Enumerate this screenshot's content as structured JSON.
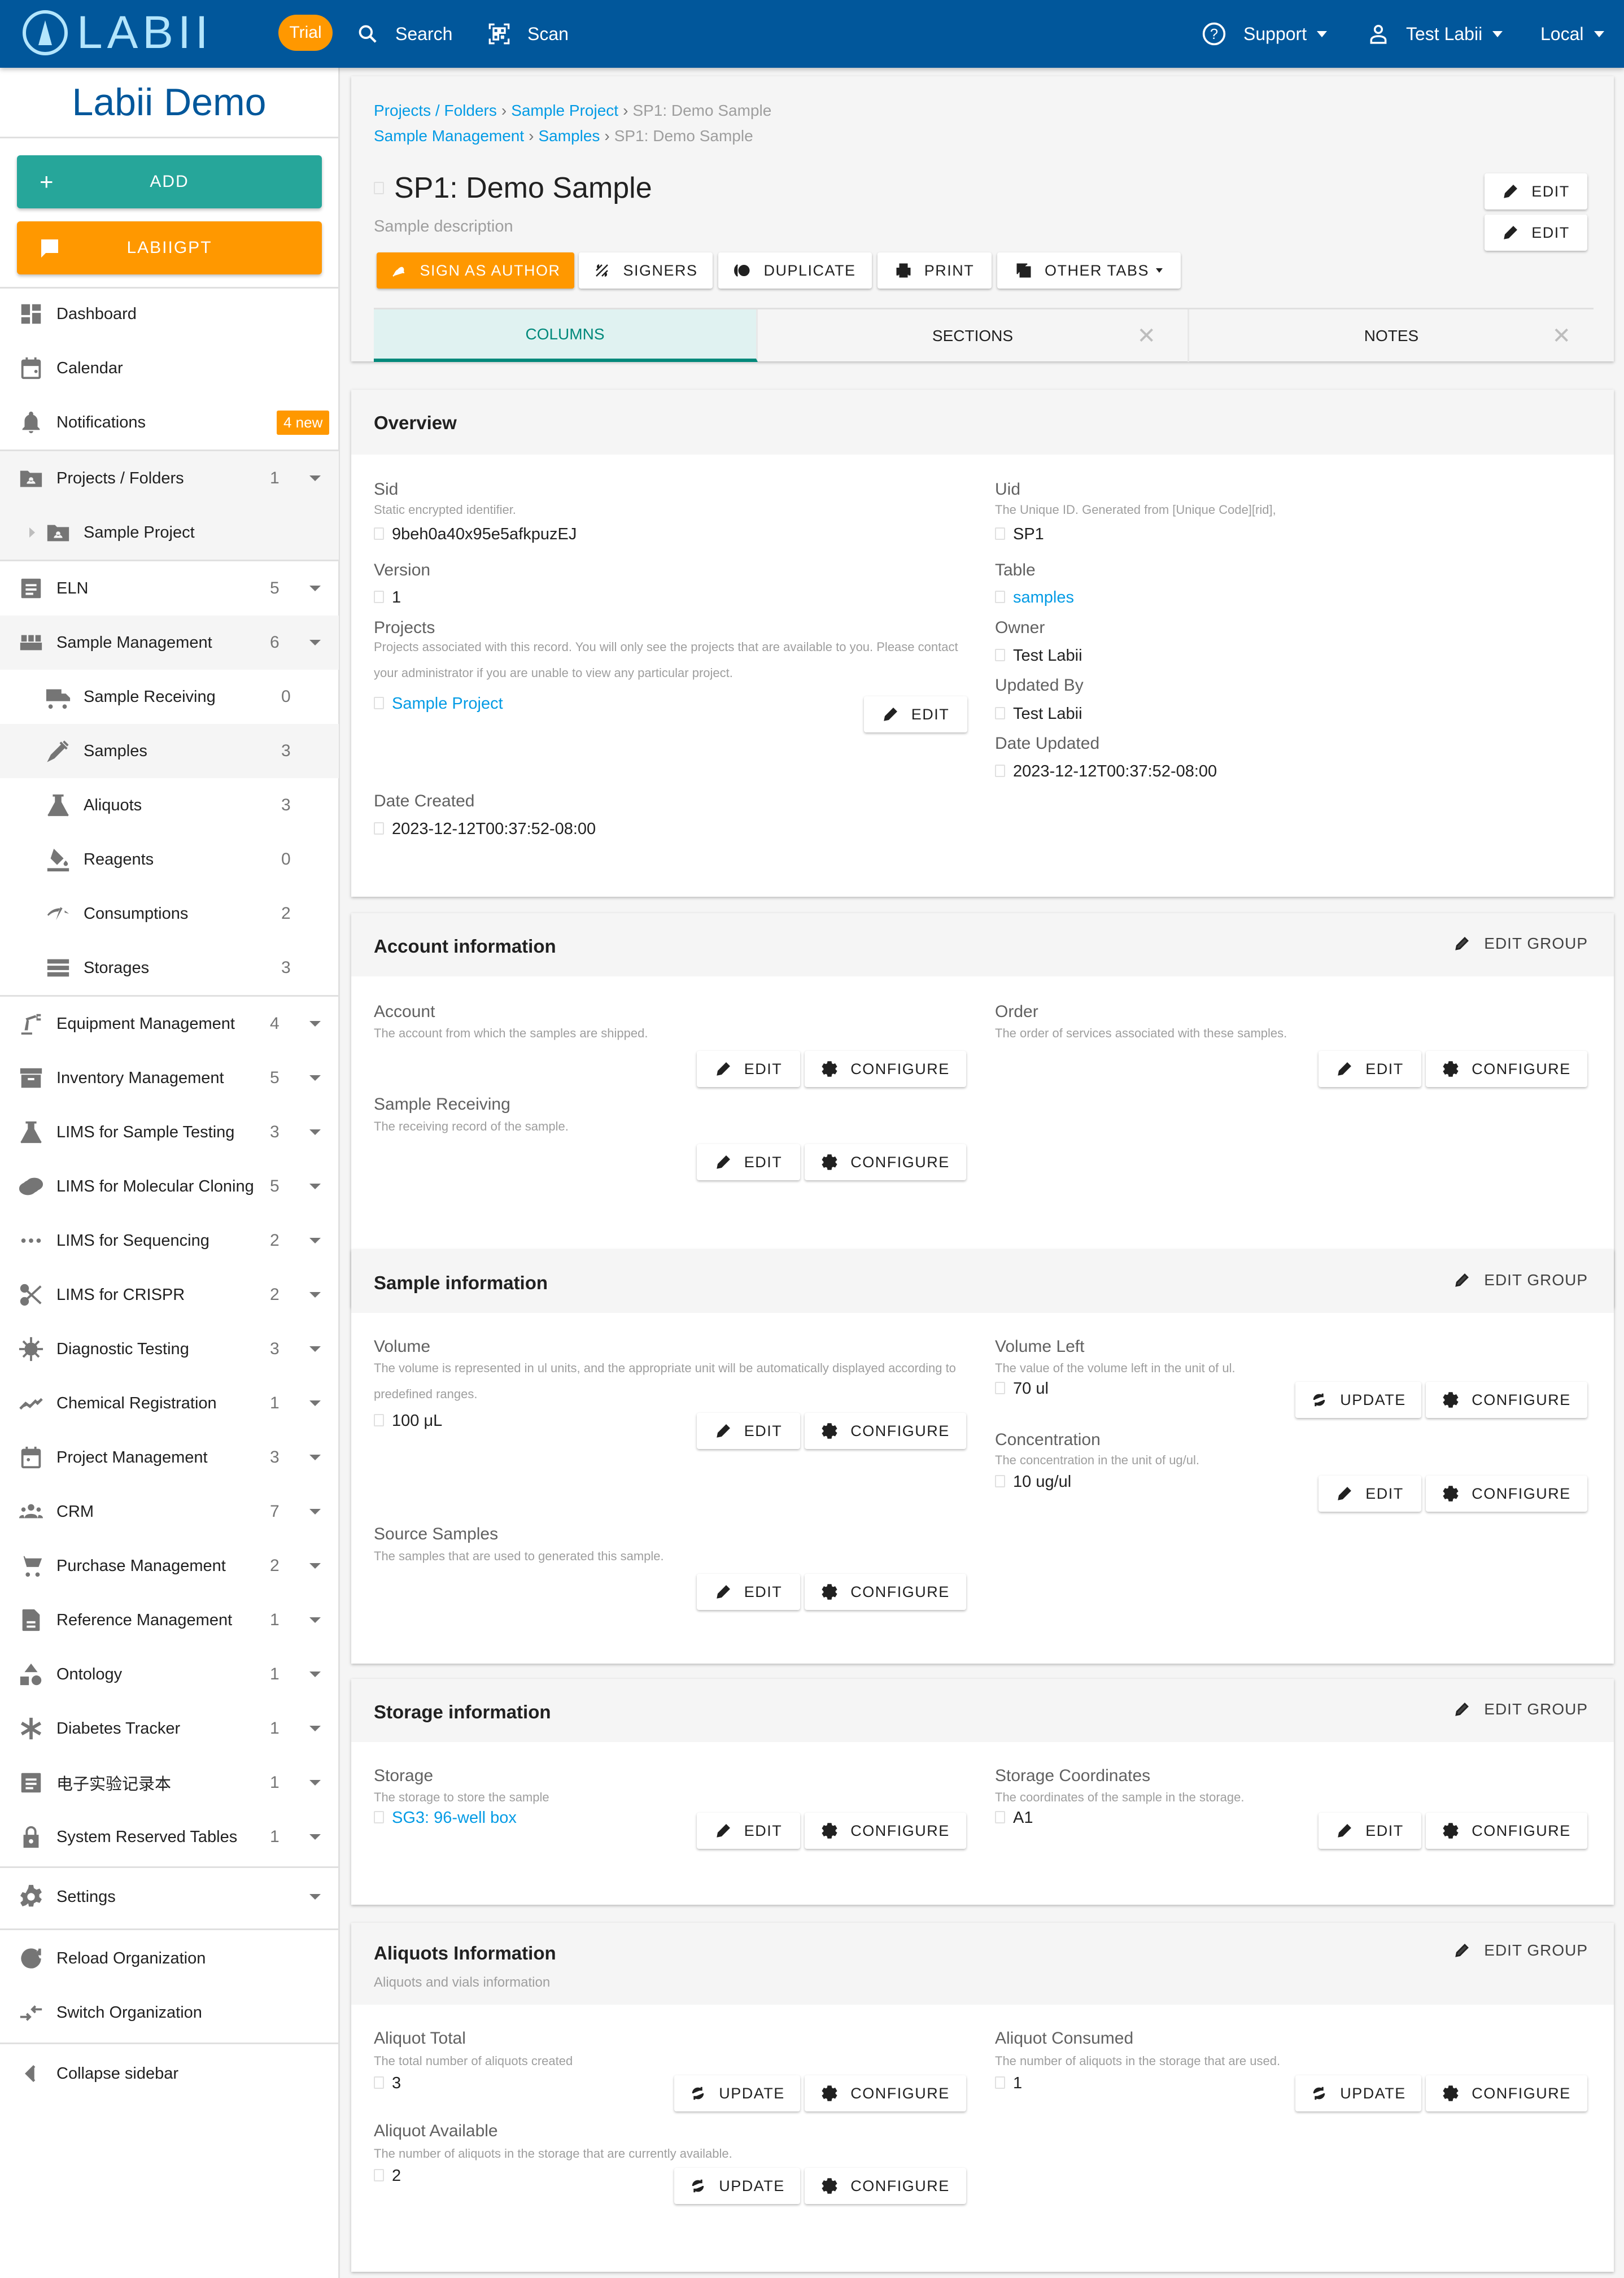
{
  "topbar": {
    "logo_text": "LABII",
    "trial_badge": "Trial",
    "search_label": "Search",
    "scan_label": "Scan",
    "support_label": "Support",
    "user_label": "Test Labii",
    "locale_label": "Local",
    "brand_color": "#01579b",
    "accent_color": "#ff9800"
  },
  "sidebar": {
    "org_title": "Labii Demo",
    "add_label": "ADD",
    "gpt_label": "LABIIGPT",
    "top_items": [
      {
        "label": "Dashboard",
        "icon": "dashboard-icon"
      },
      {
        "label": "Calendar",
        "icon": "calendar-icon"
      },
      {
        "label": "Notifications",
        "icon": "bell-icon",
        "badge": "4 new"
      }
    ],
    "projects": {
      "label": "Projects / Folders",
      "count": "1",
      "children": [
        {
          "label": "Sample Project"
        }
      ]
    },
    "eln": {
      "label": "ELN",
      "count": "5"
    },
    "sample_management": {
      "label": "Sample Management",
      "count": "6",
      "children": [
        {
          "label": "Sample Receiving",
          "count": "0"
        },
        {
          "label": "Samples",
          "count": "3",
          "active": true
        },
        {
          "label": "Aliquots",
          "count": "3"
        },
        {
          "label": "Reagents",
          "count": "0"
        },
        {
          "label": "Consumptions",
          "count": "2"
        },
        {
          "label": "Storages",
          "count": "3"
        }
      ]
    },
    "apps": [
      {
        "label": "Equipment Management",
        "count": "4"
      },
      {
        "label": "Inventory Management",
        "count": "5"
      },
      {
        "label": "LIMS for Sample Testing",
        "count": "3"
      },
      {
        "label": "LIMS for Molecular Cloning",
        "count": "5"
      },
      {
        "label": "LIMS for Sequencing",
        "count": "2"
      },
      {
        "label": "LIMS for CRISPR",
        "count": "2"
      },
      {
        "label": "Diagnostic Testing",
        "count": "3"
      },
      {
        "label": "Chemical Registration",
        "count": "1"
      },
      {
        "label": "Project Management",
        "count": "3"
      },
      {
        "label": "CRM",
        "count": "7"
      },
      {
        "label": "Purchase Management",
        "count": "2"
      },
      {
        "label": "Reference Management",
        "count": "1"
      },
      {
        "label": "Ontology",
        "count": "1"
      },
      {
        "label": "Diabetes Tracker",
        "count": "1"
      },
      {
        "label": "电子实验记录本",
        "count": "1"
      },
      {
        "label": "System Reserved Tables",
        "count": "1"
      }
    ],
    "settings_label": "Settings",
    "reload_label": "Reload Organization",
    "switch_label": "Switch Organization",
    "collapse_label": "Collapse sidebar"
  },
  "record": {
    "breadcrumb1": [
      "Projects / Folders",
      "Sample Project",
      "SP1: Demo Sample"
    ],
    "breadcrumb2": [
      "Sample Management",
      "Samples",
      "SP1: Demo Sample"
    ],
    "title": "SP1: Demo Sample",
    "description": "Sample description",
    "edit_label": "EDIT",
    "actions": {
      "sign": "SIGN AS AUTHOR",
      "signers": "SIGNERS",
      "duplicate": "DUPLICATE",
      "print": "PRINT",
      "other_tabs": "OTHER TABS"
    },
    "tabs": [
      {
        "label": "COLUMNS",
        "active": true
      },
      {
        "label": "SECTIONS",
        "closable": true
      },
      {
        "label": "NOTES",
        "closable": true
      }
    ]
  },
  "buttons": {
    "edit": "EDIT",
    "configure": "CONFIGURE",
    "update": "UPDATE",
    "edit_group": "EDIT GROUP"
  },
  "overview": {
    "title": "Overview",
    "sid": {
      "label": "Sid",
      "help": "Static encrypted identifier.",
      "value": "9beh0a40x95e5afkpuzEJ"
    },
    "version": {
      "label": "Version",
      "value": "1"
    },
    "projects": {
      "label": "Projects",
      "help": "Projects associated with this record. You will only see the projects that are available to you. Please contact your administrator if you are unable to view any particular project.",
      "value": "Sample Project"
    },
    "date_created": {
      "label": "Date Created",
      "value": "2023-12-12T00:37:52-08:00"
    },
    "uid": {
      "label": "Uid",
      "help": "The Unique ID. Generated from [Unique Code][rid],",
      "value": "SP1"
    },
    "table": {
      "label": "Table",
      "value": "samples"
    },
    "owner": {
      "label": "Owner",
      "value": "Test Labii"
    },
    "updated_by": {
      "label": "Updated By",
      "value": "Test Labii"
    },
    "date_updated": {
      "label": "Date Updated",
      "value": "2023-12-12T00:37:52-08:00"
    }
  },
  "account": {
    "title": "Account information",
    "account": {
      "label": "Account",
      "help": "The account from which the samples are shipped."
    },
    "sample_receiving": {
      "label": "Sample Receiving",
      "help": "The receiving record of the sample."
    },
    "order": {
      "label": "Order",
      "help": "The order of services associated with these samples."
    }
  },
  "sample_info": {
    "title": "Sample information",
    "volume": {
      "label": "Volume",
      "help": "The volume is represented in ul units, and the appropriate unit will be automatically displayed according to predefined ranges.",
      "value": "100 μL"
    },
    "source_samples": {
      "label": "Source Samples",
      "help": "The samples that are used to generated this sample."
    },
    "volume_left": {
      "label": "Volume Left",
      "help": "The value of the volume left in the unit of ul.",
      "value": "70 ul"
    },
    "concentration": {
      "label": "Concentration",
      "help": "The concentration in the unit of ug/ul.",
      "value": "10 ug/ul"
    }
  },
  "storage": {
    "title": "Storage information",
    "storage": {
      "label": "Storage",
      "help": "The storage to store the sample",
      "value": "SG3: 96-well box"
    },
    "coordinates": {
      "label": "Storage Coordinates",
      "help": "The coordinates of the sample in the storage.",
      "value": "A1"
    }
  },
  "aliquots": {
    "title": "Aliquots Information",
    "subtitle": "Aliquots and vials information",
    "total": {
      "label": "Aliquot Total",
      "help": "The total number of aliquots created",
      "value": "3"
    },
    "available": {
      "label": "Aliquot Available",
      "help": "The number of aliquots in the storage that are currently available.",
      "value": "2"
    },
    "consumed": {
      "label": "Aliquot Consumed",
      "help": "The number of aliquots in the storage that are used.",
      "value": "1"
    }
  }
}
